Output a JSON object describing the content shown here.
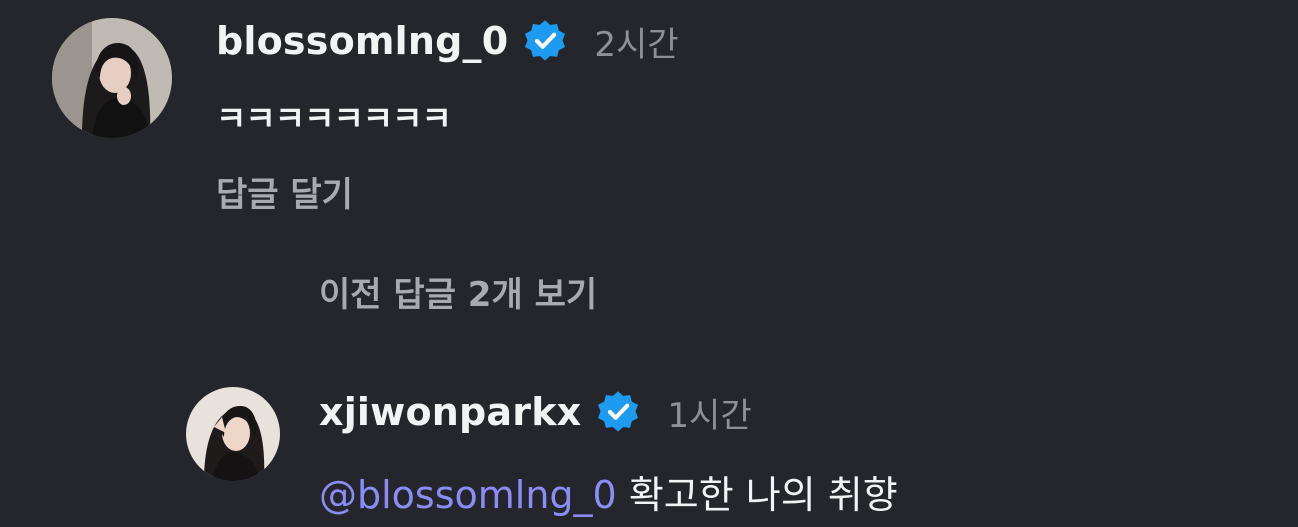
{
  "comments": [
    {
      "username": "blossomlng_0",
      "verified": true,
      "time": "2시간",
      "text": "ㅋㅋㅋㅋㅋㅋㅋㅋ",
      "reply_label": "답글 달기",
      "avatar_icon": "avatar-photo"
    }
  ],
  "thread": {
    "view_previous_label": "이전 답글 2개 보기"
  },
  "replies": [
    {
      "username": "xjiwonparkx",
      "verified": true,
      "time": "1시간",
      "mention": "@blossomlng_0",
      "text": "확고한 나의 취향",
      "avatar_icon": "avatar-photo"
    }
  ],
  "colors": {
    "background": "#24262b",
    "username": "#f2f3f5",
    "meta": "#8e9096",
    "mention": "#8b8cf6",
    "verified_badge": "#1d9bf0"
  }
}
